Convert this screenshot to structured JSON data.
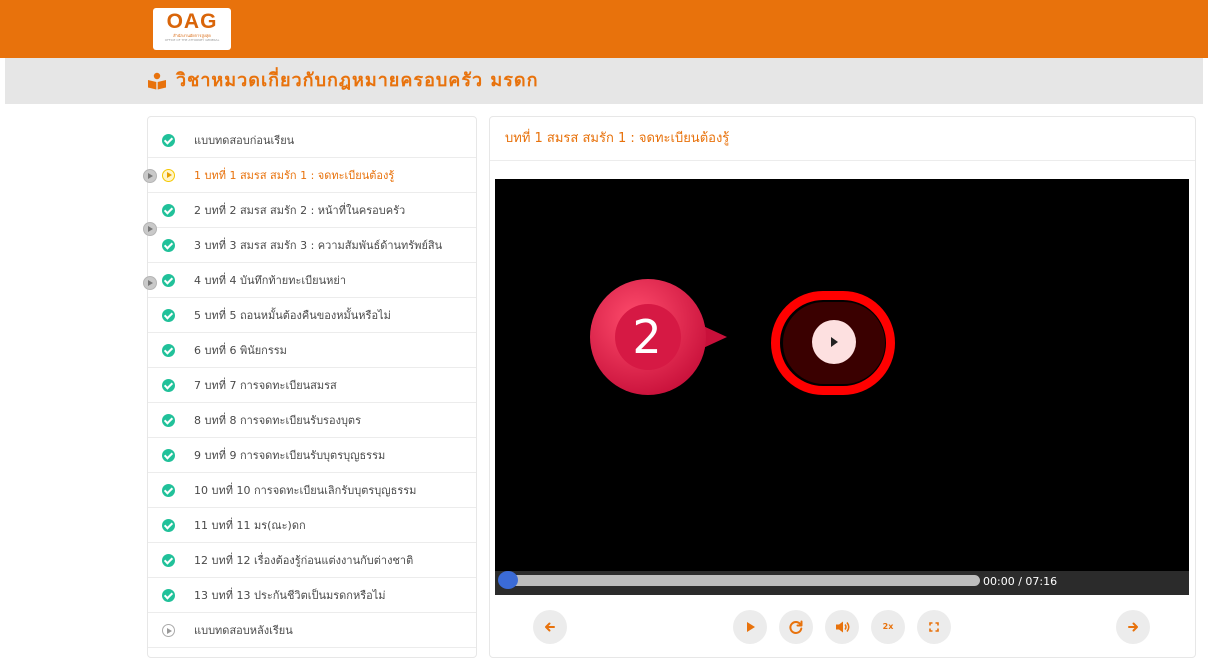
{
  "logo": {
    "text": "OAG",
    "subtitle": "สำนักงานอัยการสูงสุด",
    "subtitle_en": "OFFICE OF THE ATTORNEY GENERAL"
  },
  "course": {
    "title": "วิชาหมวดเกี่ยวกับกฎหมายครอบครัว มรดก",
    "icon": "book-reader-icon"
  },
  "lessons": [
    {
      "label": "แบบทดสอบก่อนเรียน",
      "status": "done"
    },
    {
      "label": "1 บทที่ 1 สมรส สมรัก 1 : จดทะเบียนต้องรู้",
      "status": "current"
    },
    {
      "label": "2 บทที่ 2 สมรส สมรัก 2 : หน้าที่ในครอบครัว",
      "status": "done"
    },
    {
      "label": "3 บทที่ 3 สมรส สมรัก 3 : ความสัมพันธ์ด้านทรัพย์สิน",
      "status": "done"
    },
    {
      "label": "4 บทที่ 4 บันทึกท้ายทะเบียนหย่า",
      "status": "done"
    },
    {
      "label": "5 บทที่ 5 ถอนหมั้นต้องคืนของหมั้นหรือไม่",
      "status": "done"
    },
    {
      "label": "6 บทที่ 6 พินัยกรรม",
      "status": "done"
    },
    {
      "label": "7 บทที่ 7 การจดทะเบียนสมรส",
      "status": "done"
    },
    {
      "label": "8 บทที่ 8 การจดทะเบียนรับรองบุตร",
      "status": "done"
    },
    {
      "label": "9 บทที่ 9 การจดทะเบียนรับบุตรบุญธรรม",
      "status": "done"
    },
    {
      "label": "10 บทที่ 10 การจดทะเบียนเลิกรับบุตรบุญธรรม",
      "status": "done"
    },
    {
      "label": "11 บทที่ 11 มร(ณะ)ดก",
      "status": "done"
    },
    {
      "label": "12 บทที่ 12 เรื่องต้องรู้ก่อนแต่งงานกับต่างชาติ",
      "status": "done"
    },
    {
      "label": "13 บทที่ 13 ประกันชีวิตเป็นมรดกหรือไม่",
      "status": "done"
    },
    {
      "label": "แบบทดสอบหลังเรียน",
      "status": "pending"
    }
  ],
  "player": {
    "title": "บทที่ 1 สมรส สมรัก 1 : จดทะเบียนต้องรู้",
    "time": "00:00 / 07:16",
    "progress": 0,
    "speed_label": "2x",
    "step_number": "2",
    "highlight_color": "#ff0000"
  },
  "colors": {
    "accent": "#e8720c",
    "check": "#21c19a",
    "knob": "#3b6bd6"
  }
}
